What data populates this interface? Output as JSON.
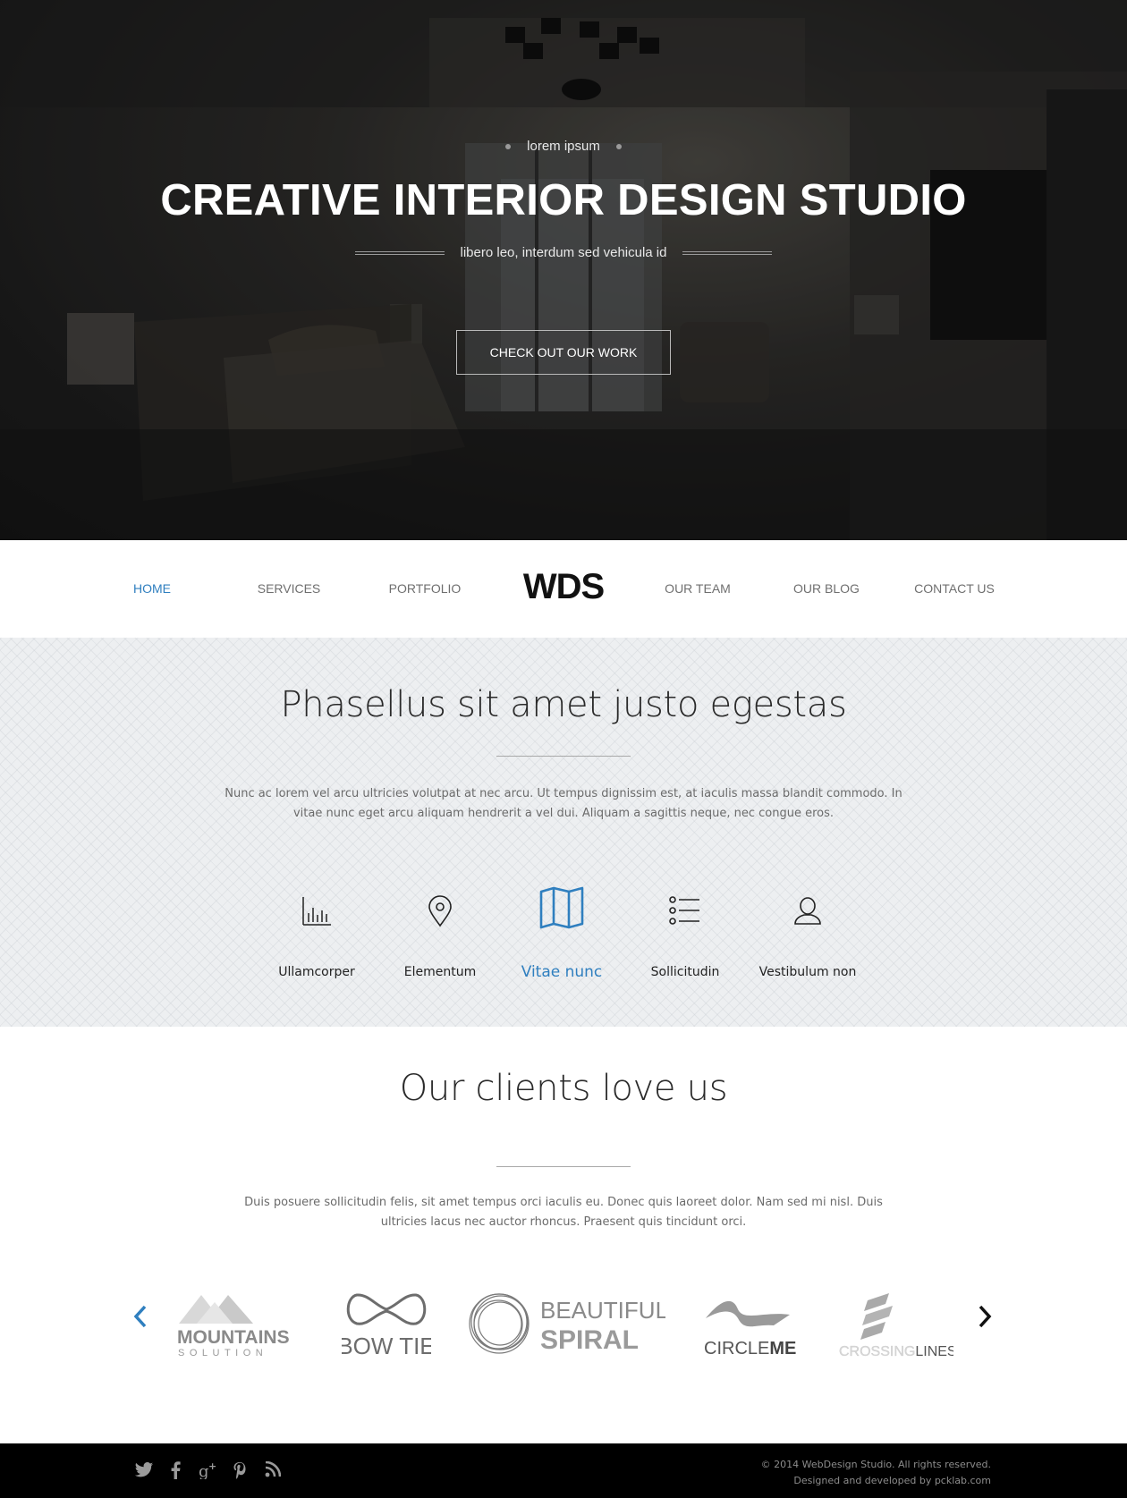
{
  "hero": {
    "eyebrow": "lorem ipsum",
    "title": "CREATIVE INTERIOR DESIGN STUDIO",
    "subtitle": "libero leo, interdum sed vehicula id",
    "cta_label": "CHECK OUT OUR WORK"
  },
  "nav": {
    "items": [
      "HOME",
      "SERVICES",
      "PORTFOLIO",
      "OUR TEAM",
      "OUR BLOG",
      "CONTACT US"
    ],
    "active": "HOME",
    "logo": "WDS"
  },
  "features": {
    "title": "Phasellus sit amet justo egestas",
    "text": "Nunc ac lorem vel arcu ultricies volutpat at nec arcu. Ut tempus dignissim est, at iaculis massa blandit commodo. In vitae nunc eget arcu aliquam hendrerit a vel dui. Aliquam a sagittis neque, nec congue eros.",
    "items": [
      {
        "label": "Ullamcorper",
        "icon": "bar-chart-icon"
      },
      {
        "label": "Elementum",
        "icon": "map-pin-icon"
      },
      {
        "label": "Vitae nunc",
        "icon": "folded-map-icon"
      },
      {
        "label": "Sollicitudin",
        "icon": "list-icon"
      },
      {
        "label": "Vestibulum non",
        "icon": "user-icon"
      }
    ],
    "active_index": 2
  },
  "clients": {
    "title": "Our clients love us",
    "text": "Duis posuere sollicitudin felis, sit amet tempus orci iaculis eu. Donec quis laoreet dolor. Nam sed mi nisl. Duis ultricies lacus nec auctor rhoncus. Praesent quis tincidunt orci.",
    "logos": [
      {
        "name": "MOUNTAINS",
        "tagline": "SOLUTION"
      },
      {
        "name": "BOW TIE"
      },
      {
        "name": "BEAUTIFUL",
        "tagline": "SPIRAL"
      },
      {
        "name": "CIRCLE",
        "tagline": "ME"
      },
      {
        "name": "CROSSING",
        "tagline": "LINES"
      }
    ]
  },
  "footer": {
    "social": [
      "twitter-icon",
      "facebook-icon",
      "google-plus-icon",
      "pinterest-icon",
      "rss-icon"
    ],
    "copyright": "© 2014 WebDesign Studio. All rights reserved.",
    "credit": "Designed and developed by pcklab.com"
  },
  "colors": {
    "accent": "#2f7fbf",
    "hero_bg": "#1d1d1d",
    "features_bg": "#edeff1",
    "footer_bg": "#000000"
  }
}
